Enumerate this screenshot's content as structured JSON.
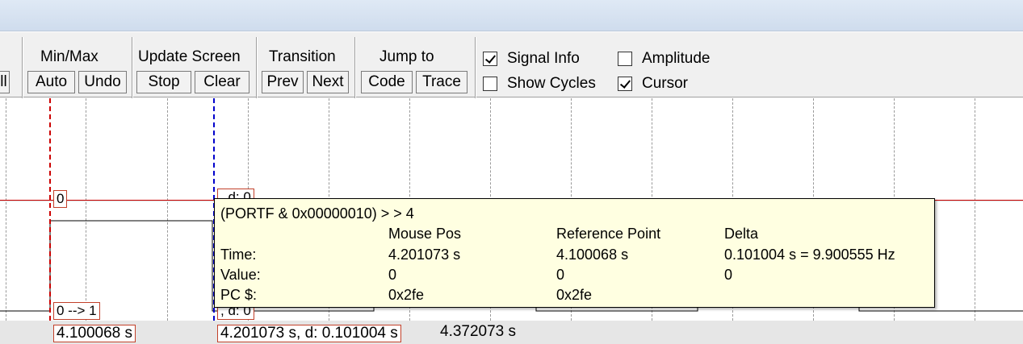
{
  "toolbar": {
    "left_partial_label": "ll",
    "minmax": {
      "title": "Min/Max",
      "auto": "Auto",
      "undo": "Undo"
    },
    "update_screen": {
      "title": "Update Screen",
      "stop": "Stop",
      "clear": "Clear"
    },
    "transition": {
      "title": "Transition",
      "prev": "Prev",
      "next": "Next"
    },
    "jump_to": {
      "title": "Jump to",
      "code": "Code",
      "trace": "Trace"
    },
    "options": {
      "signal_info": {
        "label": "Signal Info",
        "checked": true
      },
      "amplitude": {
        "label": "Amplitude",
        "checked": false
      },
      "show_cycles": {
        "label": "Show Cycles",
        "checked": false
      },
      "cursor": {
        "label": "Cursor",
        "checked": true
      }
    }
  },
  "plot": {
    "level_marker": "0",
    "transition_label": "0 --> 1",
    "hidden_label_top": ", d: 0",
    "hidden_label_bottom": ", d: 0",
    "colors": {
      "reference": "#cc0000",
      "cursor": "#0000cc",
      "label_border": "#c2402a",
      "tooltip_bg": "#ffffe1"
    }
  },
  "status": {
    "reference_time": "4.100068 s",
    "cursor_time": "4.201073 s,  d: 0.101004 s",
    "end_time": "4.372073 s"
  },
  "tooltip": {
    "expression": "(PORTF & 0x00000010) > > 4",
    "headers": {
      "mouse": "Mouse Pos",
      "reference": "Reference Point",
      "delta": "Delta"
    },
    "rows": {
      "time": {
        "label": "Time:",
        "mouse": "4.201073 s",
        "reference": "4.100068 s",
        "delta": "0.101004 s = 9.900555 Hz"
      },
      "value": {
        "label": "Value:",
        "mouse": "0",
        "reference": "0",
        "delta": "0"
      },
      "pc": {
        "label": "PC $:",
        "mouse": "0x2fe",
        "reference": "0x2fe"
      }
    }
  }
}
